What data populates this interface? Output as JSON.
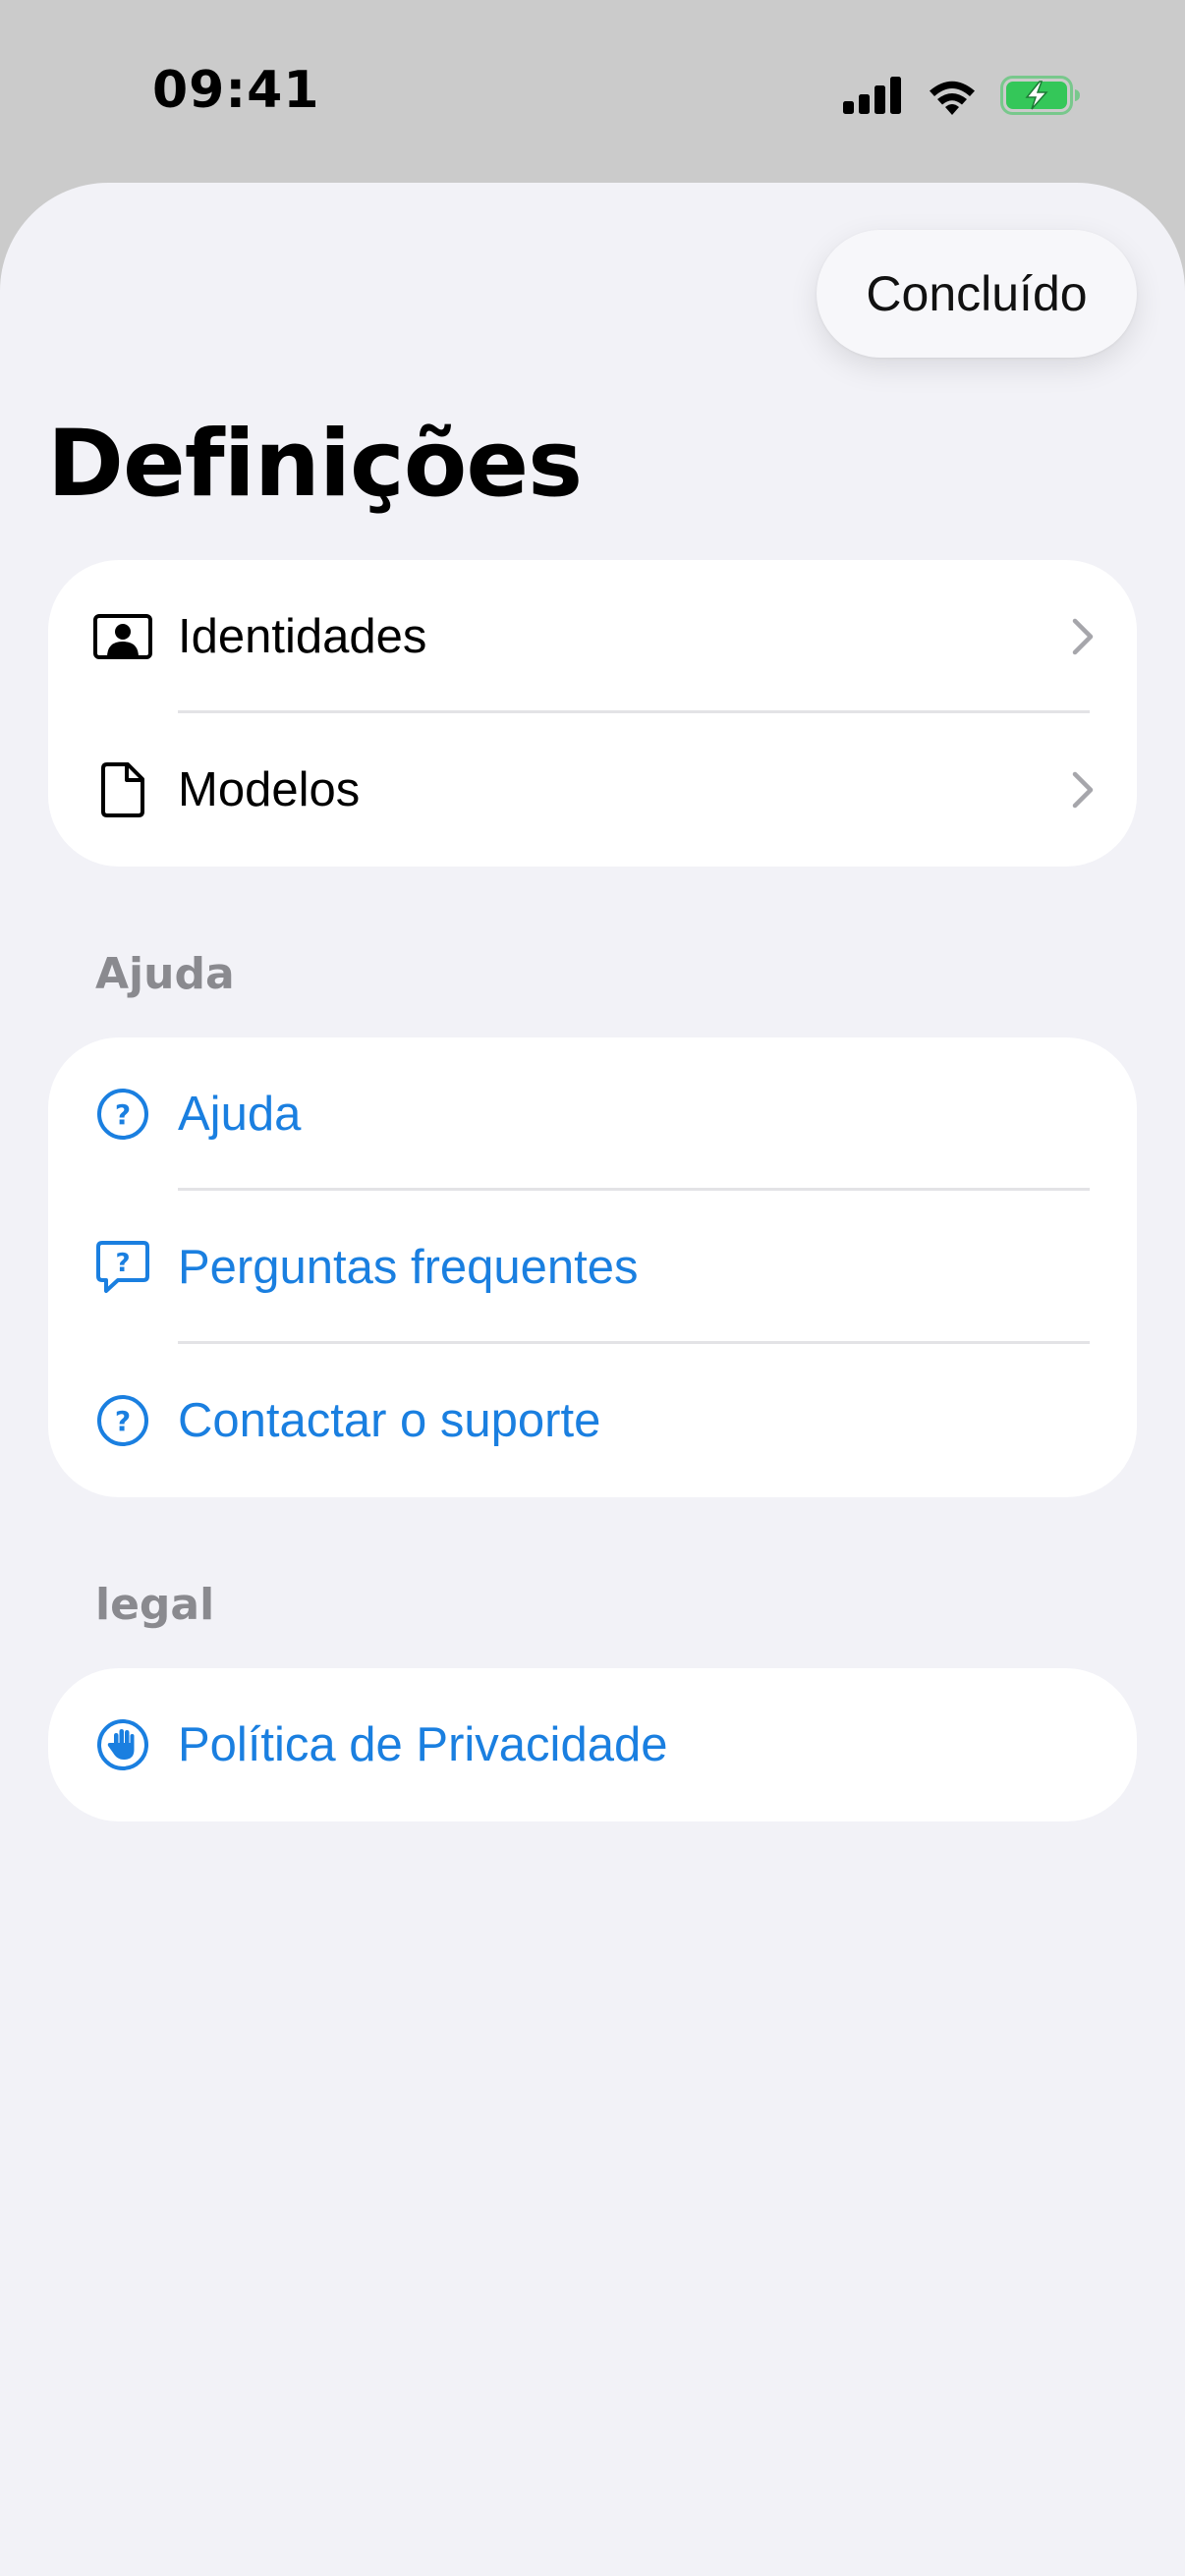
{
  "status_bar": {
    "time": "09:41",
    "icons": [
      "cellular-signal-icon",
      "wifi-icon",
      "battery-charging-icon"
    ],
    "battery_color": "#34c759"
  },
  "header": {
    "done_label": "Concluído",
    "title": "Definições"
  },
  "settings_group": {
    "items": [
      {
        "label": "Identidades",
        "icon": "contact-card-icon"
      },
      {
        "label": "Modelos",
        "icon": "document-icon"
      }
    ]
  },
  "help_section": {
    "header": "Ajuda",
    "items": [
      {
        "label": "Ajuda",
        "icon": "question-circle-icon"
      },
      {
        "label": "Perguntas frequentes",
        "icon": "question-bubble-icon"
      },
      {
        "label": "Contactar o suporte",
        "icon": "question-circle-icon"
      }
    ]
  },
  "legal_section": {
    "header": "legal",
    "items": [
      {
        "label": "Política de Privacidade",
        "icon": "hand-raised-icon"
      }
    ]
  },
  "colors": {
    "accent": "#1a7fe0",
    "background": "#f2f2f7",
    "card": "#ffffff",
    "section_header": "#8a8a8f"
  }
}
